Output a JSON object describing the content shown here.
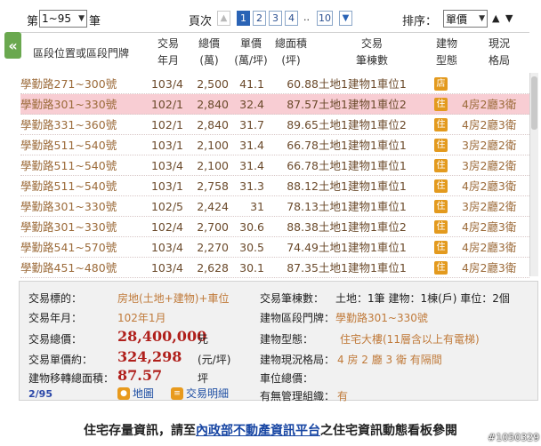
{
  "toolbar": {
    "prefix": "第",
    "range_value": "1~95",
    "suffix": "筆",
    "page_label": "頁次",
    "pages": [
      "1",
      "2",
      "3",
      "4",
      "..",
      "10"
    ],
    "sort_label": "排序：",
    "sort_value": "單價"
  },
  "table": {
    "headers": {
      "road": "區段位置或區段門牌",
      "date_1": "交易",
      "date_2": "年月",
      "total_1": "總價",
      "total_2": "(萬)",
      "unit_1": "單價",
      "unit_2": "(萬/坪)",
      "area_1": "總面積",
      "area_2": "(坪)",
      "count_1": "交易",
      "count_2": "筆棟數",
      "type_1": "建物",
      "type_2": "型態",
      "layout_1": "現況",
      "layout_2": "格局"
    },
    "rows": [
      {
        "road": "學勤路271~300號",
        "date": "103/4",
        "total": "2,500",
        "unit": "41.1",
        "area": "60.88",
        "count": "土地1建物1車位1",
        "type": "店",
        "layout": ""
      },
      {
        "road": "學勤路301~330號",
        "date": "102/1",
        "total": "2,840",
        "unit": "32.4",
        "area": "87.57",
        "count": "土地1建物1車位2",
        "type": "住",
        "layout": "4房2廳3衛"
      },
      {
        "road": "學勤路331~360號",
        "date": "102/1",
        "total": "2,840",
        "unit": "31.7",
        "area": "89.65",
        "count": "土地1建物1車位2",
        "type": "住",
        "layout": "4房2廳3衛"
      },
      {
        "road": "學勤路511~540號",
        "date": "103/1",
        "total": "2,100",
        "unit": "31.4",
        "area": "66.78",
        "count": "土地1建物1車位1",
        "type": "住",
        "layout": "3房2廳2衛"
      },
      {
        "road": "學勤路511~540號",
        "date": "103/4",
        "total": "2,100",
        "unit": "31.4",
        "area": "66.78",
        "count": "土地1建物1車位1",
        "type": "住",
        "layout": "3房2廳2衛"
      },
      {
        "road": "學勤路511~540號",
        "date": "103/1",
        "total": "2,758",
        "unit": "31.3",
        "area": "88.12",
        "count": "土地1建物1車位1",
        "type": "住",
        "layout": "4房2廳3衛"
      },
      {
        "road": "學勤路301~330號",
        "date": "102/5",
        "total": "2,424",
        "unit": "31",
        "area": "78.13",
        "count": "土地1建物1車位1",
        "type": "住",
        "layout": "3房2廳2衛"
      },
      {
        "road": "學勤路301~330號",
        "date": "102/4",
        "total": "2,700",
        "unit": "30.6",
        "area": "88.38",
        "count": "土地1建物1車位2",
        "type": "住",
        "layout": "4房2廳3衛"
      },
      {
        "road": "學勤路541~570號",
        "date": "103/4",
        "total": "2,270",
        "unit": "30.5",
        "area": "74.49",
        "count": "土地1建物1車位1",
        "type": "住",
        "layout": "4房2廳3衛"
      },
      {
        "road": "學勤路451~480號",
        "date": "103/4",
        "total": "2,628",
        "unit": "30.1",
        "area": "87.35",
        "count": "土地1建物1車位1",
        "type": "住",
        "layout": "4房2廳3衛"
      }
    ]
  },
  "detail": {
    "target_label": "交易標的：",
    "target_value": "房地(土地+建物)+車位",
    "date_label": "交易年月：",
    "date_value": "102年1月",
    "total_label": "交易總價：",
    "total_value": "28,400,000",
    "total_unit": "元",
    "unit_label": "交易單價約：",
    "unit_value": "324,298",
    "unit_unit": "(元/坪)",
    "area_label": "建物移轉總面積：",
    "area_value": "87.57",
    "area_unit": "坪",
    "count_label": "交易筆棟數：",
    "count_value": "土地：1筆 建物：1棟(戶) 車位：2個",
    "addr_label": "建物區段門牌：",
    "addr_value": "學勤路301~330號",
    "btype_label": "建物型態：",
    "btype_value": "住宅大樓(11層含以上有電梯)",
    "layout_label": "建物現況格局：",
    "layout_value": "4 房 2 廳 3 衛 有隔間",
    "parking_label": "車位總價：",
    "parking_value": "",
    "mgmt_label": "有無管理組織：",
    "mgmt_value": "有",
    "record_index": "2/95",
    "map_button": "地圖",
    "detail_button": "交易明細"
  },
  "footer": {
    "before": "住宅存量資訊，請至",
    "link": "內政部不動產資訊平台",
    "after": "之住宅資訊動態看板參閱"
  },
  "watermark": "#1050329",
  "colors": {
    "accent": "#2a63b5",
    "selected_row": "#f8cdd3",
    "type_badge": "#e39a1e",
    "price_red": "#b0201c",
    "side_tab": "#6aa84f"
  }
}
